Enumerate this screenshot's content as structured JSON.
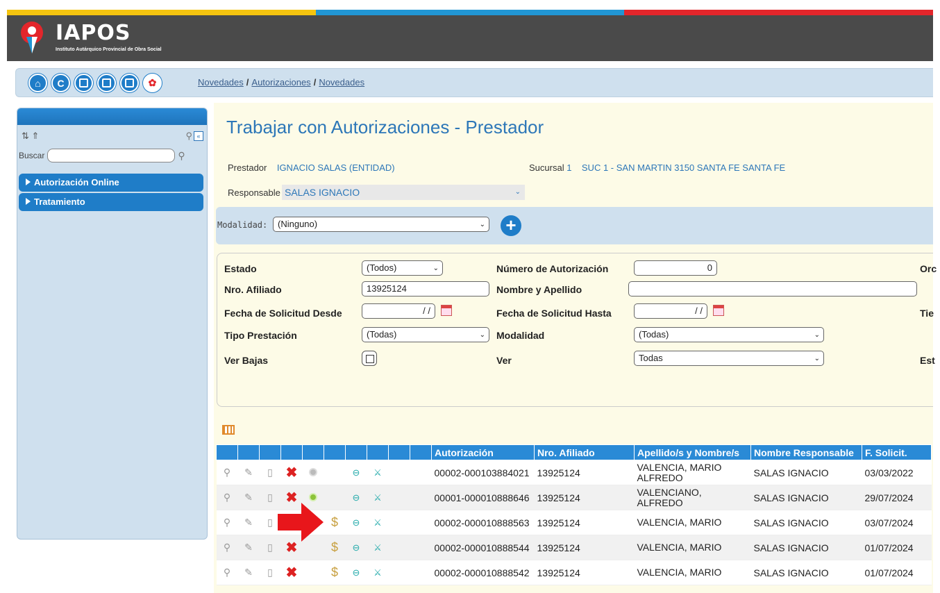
{
  "colors": {
    "yellow": "#f5c40f",
    "blue": "#2196d4",
    "red": "#e3262b",
    "primary": "#1f7dc8",
    "title": "#2d77b8"
  },
  "logo": {
    "name": "IAPOS",
    "subtitle": "Instituto Autárquico Provincial de Obra Social"
  },
  "nav": {
    "icons": [
      "home-icon",
      "refresh-icon",
      "list-icon",
      "grid-icon",
      "window-icon",
      "color-icon"
    ],
    "breadcrumb": [
      "Novedades",
      "Autorizaciones",
      "Novedades"
    ],
    "separator": "/"
  },
  "sidebar": {
    "search_label": "Buscar",
    "search_value": "",
    "menu": [
      "Autorización Online",
      "Tratamiento"
    ]
  },
  "page": {
    "title": "Trabajar con Autorizaciones - Prestador",
    "prestador_label": "Prestador",
    "prestador_value": "IGNACIO SALAS (ENTIDAD)",
    "sucursal_label": "Sucursal",
    "sucursal_num": "1",
    "sucursal_value": "SUC 1 - SAN MARTIN 3150 SANTA FE SANTA FE",
    "responsable_label": "Responsable",
    "responsable_value": "SALAS IGNACIO",
    "modalidad_label": "Modalidad:",
    "modalidad_value": "(Ninguno)"
  },
  "filters": {
    "estado_label": "Estado",
    "estado_value": "(Todos)",
    "numero_label": "Número de Autorización",
    "numero_value": "0",
    "orden_label": "Orc",
    "afiliado_label": "Nro. Afiliado",
    "afiliado_value": "13925124",
    "nombre_label": "Nombre y Apellido",
    "nombre_value": "",
    "desde_label": "Fecha de Solicitud Desde",
    "desde_value": "/ /",
    "hasta_label": "Fecha de Solicitud Hasta",
    "hasta_value": "/ /",
    "tie_label": "Tie",
    "tipo_label": "Tipo Prestación",
    "tipo_value": "(Todas)",
    "modalidad_label": "Modalidad",
    "modalidad_value": "(Todas)",
    "bajas_label": "Ver Bajas",
    "ver_label": "Ver",
    "ver_value": "Todas",
    "est_label": "Est"
  },
  "table": {
    "headers": [
      "",
      "",
      "",
      "",
      "",
      "",
      "",
      "",
      "",
      "",
      "Autorización",
      "Nro. Afiliado",
      "Apellido/s y Nombre/s",
      "Nombre Responsable",
      "F. Solicit."
    ],
    "rows": [
      {
        "autorizacion": "00002-000103884021",
        "afiliado": "13925124",
        "nombre": "VALENCIA, MARIO ALFREDO",
        "responsable": "SALAS IGNACIO",
        "fecha": "03/03/2022",
        "estado": "grey",
        "dollar": false
      },
      {
        "autorizacion": "00001-000010888646",
        "afiliado": "13925124",
        "nombre": "VALENCIANO, ALFREDO",
        "responsable": "SALAS IGNACIO",
        "fecha": "29/07/2024",
        "estado": "green",
        "dollar": false
      },
      {
        "autorizacion": "00002-000010888563",
        "afiliado": "13925124",
        "nombre": "VALENCIA, MARIO",
        "responsable": "SALAS IGNACIO",
        "fecha": "03/07/2024",
        "estado": "none",
        "dollar": true
      },
      {
        "autorizacion": "00002-000010888544",
        "afiliado": "13925124",
        "nombre": "VALENCIA, MARIO",
        "responsable": "SALAS IGNACIO",
        "fecha": "01/07/2024",
        "estado": "none",
        "dollar": true
      },
      {
        "autorizacion": "00002-000010888542",
        "afiliado": "13925124",
        "nombre": "VALENCIA, MARIO",
        "responsable": "SALAS IGNACIO",
        "fecha": "01/07/2024",
        "estado": "none",
        "dollar": true
      }
    ]
  },
  "icon_glyphs": {
    "view": "⚲",
    "edit": "✎",
    "delete": "▯",
    "cancel": "✖",
    "dollar": "$",
    "print": "⊖",
    "mail": "⚔"
  }
}
